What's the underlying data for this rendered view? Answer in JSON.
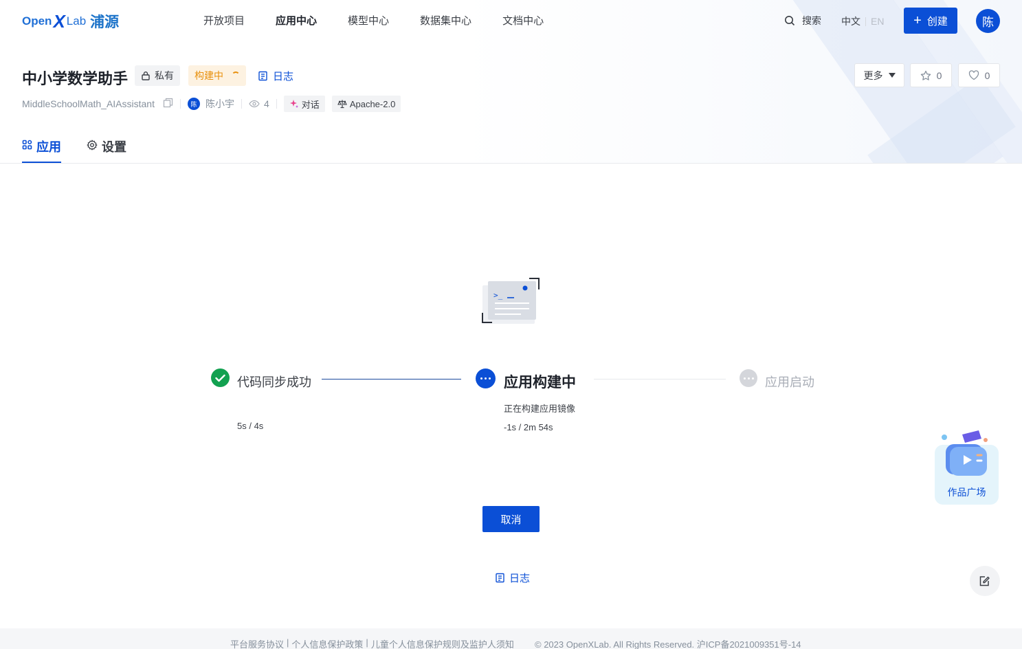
{
  "brand": {
    "open": "Open",
    "x": "X",
    "lab": "Lab",
    "cn": "浦源",
    "color": "#0b4fd6"
  },
  "nav": {
    "items": [
      {
        "label": "开放项目",
        "active": false
      },
      {
        "label": "应用中心",
        "active": true
      },
      {
        "label": "模型中心",
        "active": false
      },
      {
        "label": "数据集中心",
        "active": false
      },
      {
        "label": "文档中心",
        "active": false
      }
    ],
    "search_label": "搜索",
    "lang_zh": "中文",
    "lang_en": "EN",
    "create_label": "创建",
    "avatar_initial": "陈"
  },
  "project": {
    "title": "中小学数学助手",
    "visibility": "私有",
    "status": "构建中",
    "status_color": "#e8900c",
    "log_label": "日志",
    "repo_name": "MiddleSchoolMath_AIAssistant",
    "owner_initial": "陈",
    "owner": "陈小宇",
    "views": "4",
    "category": "对话",
    "license": "Apache-2.0",
    "more_label": "更多",
    "stars": "0",
    "likes": "0"
  },
  "tabs": [
    {
      "label": "应用",
      "icon": "apps-icon",
      "active": true
    },
    {
      "label": "设置",
      "icon": "gear-icon",
      "active": false
    }
  ],
  "build": {
    "steps": [
      {
        "label": "代码同步成功",
        "state": "done",
        "time": "5s / 4s"
      },
      {
        "label": "应用构建中",
        "state": "in-progress",
        "desc": "正在构建应用镜像",
        "time": "-1s / 2m 54s"
      },
      {
        "label": "应用启动",
        "state": "pending"
      }
    ],
    "cancel_label": "取消",
    "log_label": "日志",
    "colors": {
      "done": "#12a150",
      "active": "#0b4fd6",
      "pending": "#d4d6db"
    }
  },
  "widgets": {
    "gallery_label": "作品广场"
  },
  "footer": {
    "links": [
      "平台服务协议",
      "个人信息保护政策",
      "儿童个人信息保护规则及监护人须知"
    ],
    "copyright": "© 2023 OpenXLab. All Rights Reserved. 沪ICP备2021009351号-14"
  }
}
